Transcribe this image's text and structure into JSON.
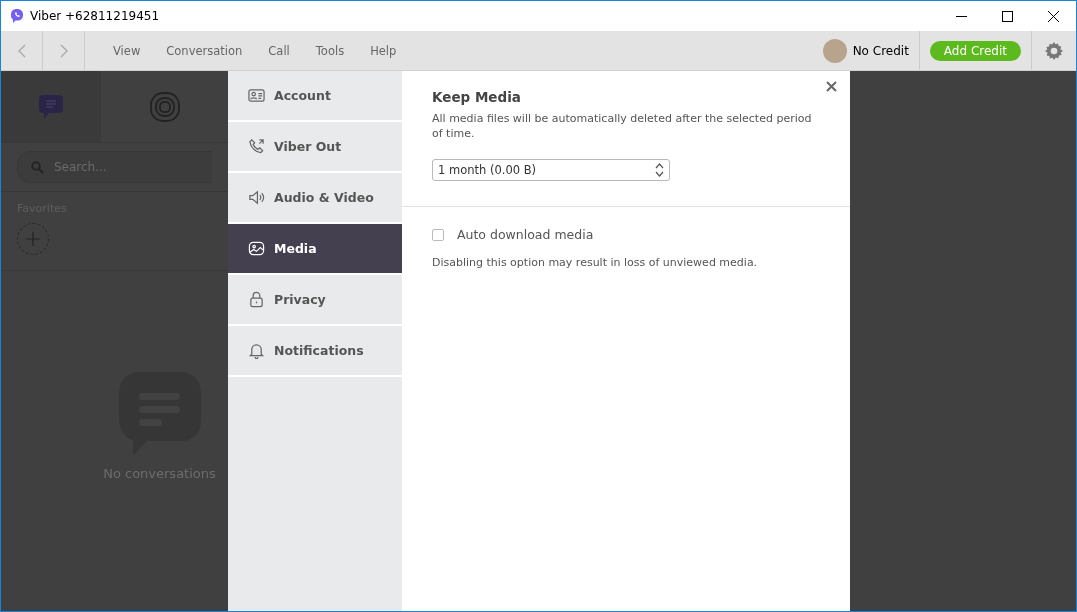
{
  "window": {
    "title": "Viber +62811219451"
  },
  "toolbar": {
    "menu": [
      "View",
      "Conversation",
      "Call",
      "Tools",
      "Help"
    ],
    "account": "No Credit",
    "add_credit": "Add Credit"
  },
  "sidebar": {
    "tabs": [
      {
        "kind": "chats",
        "selected": true
      },
      {
        "kind": "calls",
        "selected": false
      }
    ],
    "search": {
      "placeholder": "Search..."
    },
    "favorites": "Favorites",
    "empty": "No conversations"
  },
  "settings": {
    "nav": [
      {
        "kind": "account",
        "label": "Account",
        "selected": false
      },
      {
        "kind": "phone",
        "label": "Viber Out",
        "selected": false
      },
      {
        "kind": "speaker",
        "label": "Audio & Video",
        "selected": false
      },
      {
        "kind": "media",
        "label": "Media",
        "selected": true
      },
      {
        "kind": "lock",
        "label": "Privacy",
        "selected": false
      },
      {
        "kind": "bell",
        "label": "Notifications",
        "selected": false
      }
    ],
    "keep_media": {
      "title": "Keep Media",
      "description": "All media files will be automatically deleted after the selected period of time.",
      "value": "1 month (0.00 B)"
    },
    "auto_download": {
      "label": "Auto download media",
      "checked": false,
      "note": "Disabling this option may result in loss of unviewed media."
    }
  }
}
